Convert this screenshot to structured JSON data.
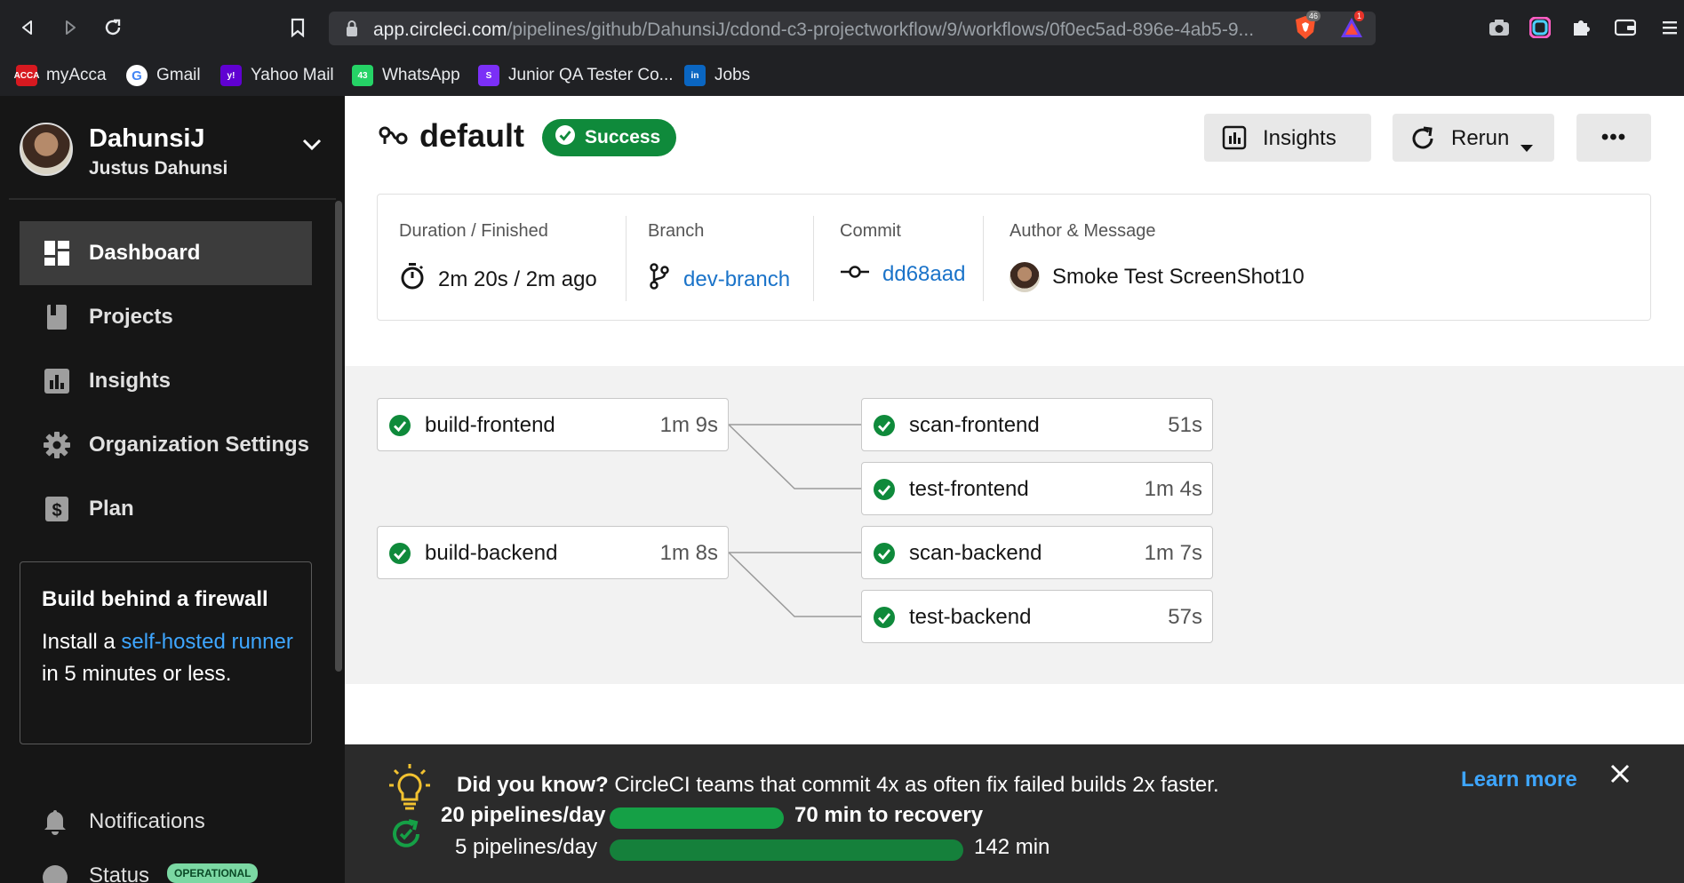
{
  "browser": {
    "url_host": "app.circleci.com",
    "url_path": "/pipelines/github/DahunsiJ/cdond-c3-projectworkflow/9/workflows/0f0ec5ad-896e-4ab5-9...",
    "brave_badge": "46",
    "alert_badge": "1",
    "bookmarks": [
      {
        "label": "myAcca",
        "icon": "acca-icon",
        "color": "#d71920",
        "glyph": "ACCA"
      },
      {
        "label": "Gmail",
        "icon": "google-icon",
        "color": "#ffffff",
        "glyph": "G"
      },
      {
        "label": "Yahoo Mail",
        "icon": "yahoo-icon",
        "color": "#6001d2",
        "glyph": "y!"
      },
      {
        "label": "WhatsApp",
        "icon": "whatsapp-icon",
        "color": "#25d366",
        "glyph": "43"
      },
      {
        "label": "Junior QA Tester Co...",
        "icon": "stripe-icon",
        "color": "#7b2ff7",
        "glyph": "S"
      },
      {
        "label": "Jobs",
        "icon": "linkedin-icon",
        "color": "#0a66c2",
        "glyph": "in"
      }
    ]
  },
  "sidebar": {
    "username": "DahunsiJ",
    "fullname": "Justus Dahunsi",
    "items": [
      {
        "label": "Dashboard",
        "icon": "dashboard-icon",
        "active": true
      },
      {
        "label": "Projects",
        "icon": "projects-icon",
        "active": false
      },
      {
        "label": "Insights",
        "icon": "insights-icon",
        "active": false
      },
      {
        "label": "Organization Settings",
        "icon": "gear-icon",
        "active": false
      },
      {
        "label": "Plan",
        "icon": "dollar-icon",
        "active": false
      }
    ],
    "firewall": {
      "title": "Build behind a firewall",
      "text_pre": "Install a ",
      "link": "self-hosted runner",
      "text_post": " in 5 minutes or less."
    },
    "notifications": "Notifications",
    "status_label": "Status",
    "status_badge": "OPERATIONAL"
  },
  "workflow": {
    "name": "default",
    "status": "Success",
    "insights_label": "Insights",
    "rerun_label": "Rerun",
    "more_label": "•••"
  },
  "info": {
    "duration_label": "Duration / Finished",
    "duration_value": "2m 20s / 2m ago",
    "branch_label": "Branch",
    "branch_value": "dev-branch",
    "commit_label": "Commit",
    "commit_value": "dd68aad",
    "author_label": "Author & Message",
    "author_value": "Smoke Test ScreenShot10"
  },
  "jobs": [
    {
      "name": "build-frontend",
      "time": "1m 9s"
    },
    {
      "name": "scan-frontend",
      "time": "51s"
    },
    {
      "name": "test-frontend",
      "time": "1m 4s"
    },
    {
      "name": "build-backend",
      "time": "1m 8s"
    },
    {
      "name": "scan-backend",
      "time": "1m 7s"
    },
    {
      "name": "test-backend",
      "time": "57s"
    }
  ],
  "did_you_know": {
    "lead": "Did you know?",
    "text": " CircleCI teams that commit 4x as often fix failed builds 2x faster.",
    "learn_more": "Learn more",
    "stats": [
      {
        "label": "20 pipelines/day",
        "time": "70 min to recovery",
        "bar_fraction": 0.36
      },
      {
        "label": "5 pipelines/day",
        "time": "142 min",
        "bar_fraction": 0.73
      }
    ]
  },
  "colors": {
    "success": "#0f8a3b",
    "link": "#1a73c9",
    "sidebar_bg": "#161616",
    "accent_green": "#15a046"
  }
}
